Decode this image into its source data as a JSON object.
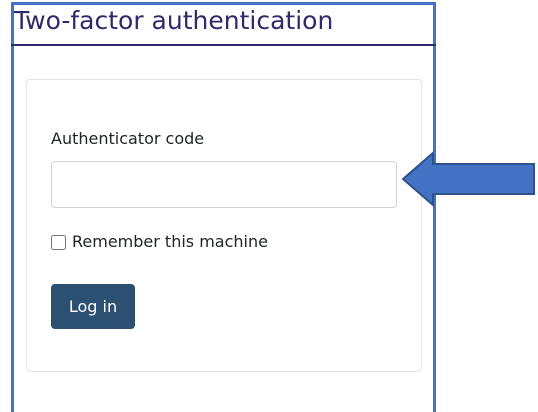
{
  "page": {
    "title": "Two-factor authentication"
  },
  "form": {
    "code_label": "Authenticator code",
    "code_value": "",
    "remember_label": "Remember this machine",
    "remember_checked": false,
    "login_label": "Log in"
  },
  "annotation": {
    "arrow": "left-pointing-arrow"
  },
  "colors": {
    "title": "#2e2a6b",
    "frame_border": "#4472c4",
    "button_bg": "#2c5071",
    "arrow_fill": "#4472c4",
    "arrow_stroke": "#2f528f"
  }
}
